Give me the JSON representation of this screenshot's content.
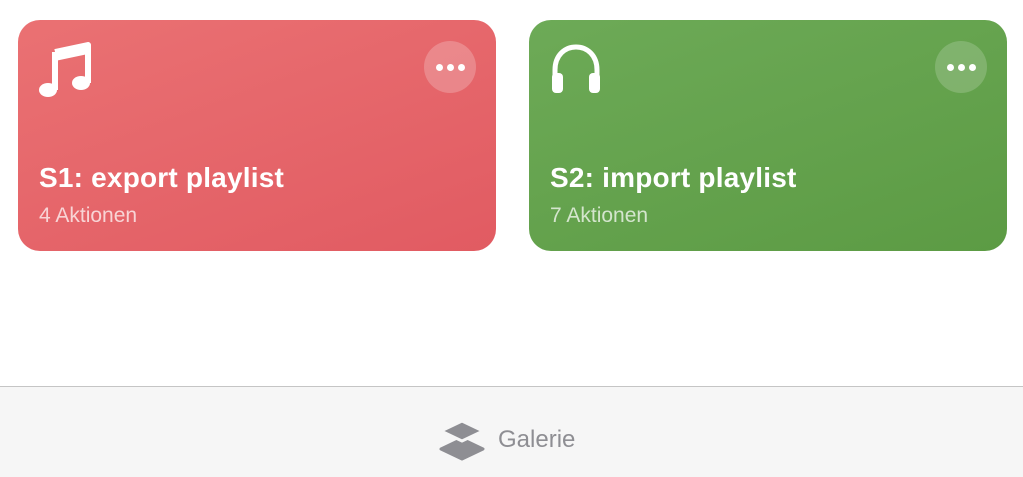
{
  "shortcuts": [
    {
      "title": "S1: export playlist",
      "subtitle": "4 Aktionen",
      "icon": "music-note-icon",
      "color": "#e5636a"
    },
    {
      "title": "S2: import playlist",
      "subtitle": "7 Aktionen",
      "icon": "headphones-icon",
      "color": "#64a24d"
    }
  ],
  "tabbar": {
    "gallery_label": "Galerie",
    "gallery_icon": "stacked-layers-icon",
    "inactive_color": "#8e8e93"
  }
}
